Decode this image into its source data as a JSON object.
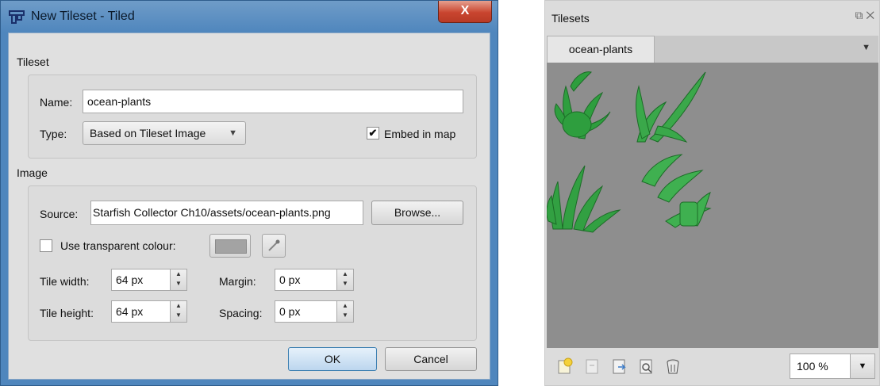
{
  "dialog": {
    "title": "New Tileset - Tiled",
    "close_label": "X",
    "tileset_section": "Tileset",
    "name_label": "Name:",
    "name_value": "ocean-plants",
    "type_label": "Type:",
    "type_value": "Based on Tileset Image",
    "embed_label": "Embed in map",
    "embed_checked": true,
    "image_section": "Image",
    "source_label": "Source:",
    "source_value": "Starfish Collector Ch10/assets/ocean-plants.png",
    "browse_label": "Browse...",
    "transparent_label": "Use transparent colour:",
    "transparent_checked": false,
    "transparent_color": "#a3a3a3",
    "tile_width_label": "Tile width:",
    "tile_width_value": "64 px",
    "tile_height_label": "Tile height:",
    "tile_height_value": "64 px",
    "margin_label": "Margin:",
    "margin_value": "0 px",
    "spacing_label": "Spacing:",
    "spacing_value": "0 px",
    "ok_label": "OK",
    "cancel_label": "Cancel"
  },
  "panel": {
    "title": "Tilesets",
    "tab_label": "ocean-plants",
    "zoom_value": "100 %",
    "tile_bg": "#8e8e8e",
    "plant_color": "#2e9e3e",
    "toolbar_icons": [
      "new-tileset-icon",
      "import-tileset-icon",
      "export-tileset-icon",
      "tileset-properties-icon",
      "remove-tileset-icon"
    ]
  }
}
